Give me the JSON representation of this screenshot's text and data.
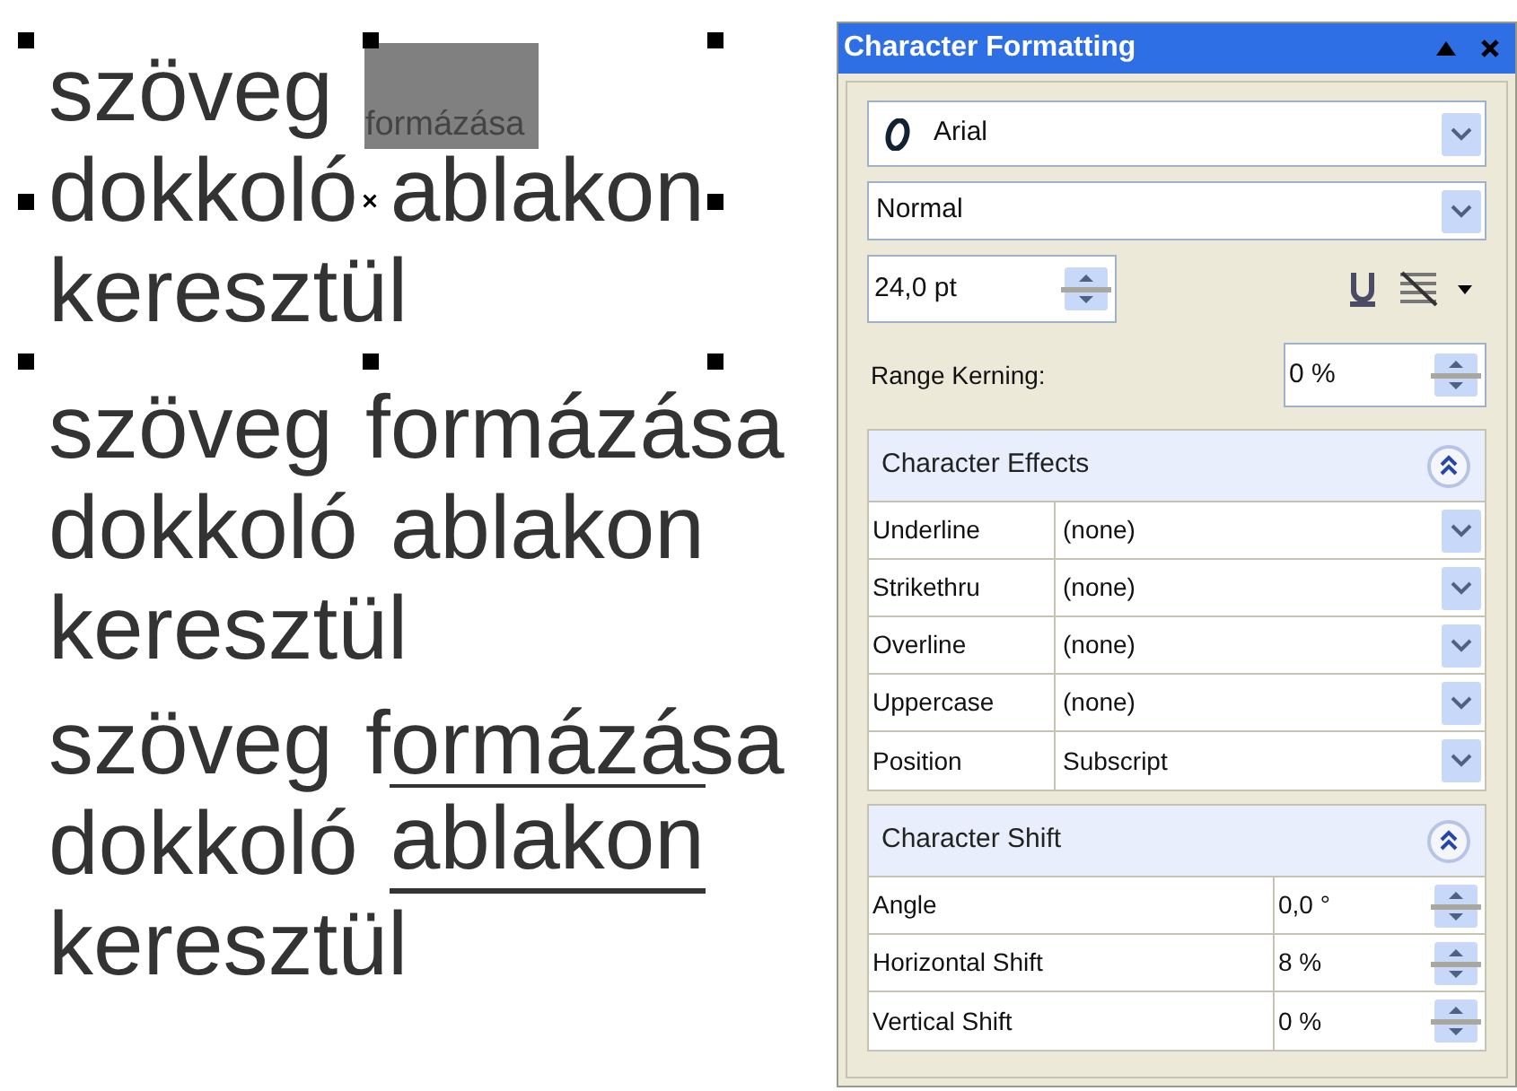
{
  "canvas": {
    "text_blocks": [
      {
        "selected": true,
        "lines": [
          [
            {
              "text": "szöveg",
              "highlighted": false,
              "subscript": false,
              "underline": false,
              "overline": false
            },
            {
              "text": "formázása",
              "highlighted": true,
              "subscript": true,
              "underline": false,
              "overline": false
            }
          ],
          [
            {
              "text": "dokkoló",
              "highlighted": false,
              "subscript": false,
              "underline": false,
              "overline": false
            },
            {
              "text": "ablakon",
              "highlighted": false,
              "subscript": false,
              "underline": false,
              "overline": false
            }
          ],
          [
            {
              "text": "keresztül",
              "highlighted": false,
              "subscript": false,
              "underline": false,
              "overline": false
            }
          ]
        ]
      },
      {
        "selected": false,
        "lines": [
          [
            {
              "text": "szöveg",
              "highlighted": false,
              "subscript": false,
              "underline": false,
              "overline": false
            },
            {
              "text": "formázása",
              "highlighted": false,
              "subscript": false,
              "underline": false,
              "overline": false
            }
          ],
          [
            {
              "text": "dokkoló",
              "highlighted": false,
              "subscript": false,
              "underline": false,
              "overline": false
            },
            {
              "text": "ablakon",
              "highlighted": false,
              "subscript": false,
              "underline": false,
              "overline": false
            }
          ],
          [
            {
              "text": "keresztül",
              "highlighted": false,
              "subscript": false,
              "underline": false,
              "overline": false
            }
          ]
        ]
      },
      {
        "selected": false,
        "lines": [
          [
            {
              "text": "szöveg",
              "highlighted": false,
              "subscript": false,
              "underline": false,
              "overline": false
            },
            {
              "text": "formázása",
              "highlighted": false,
              "subscript": false,
              "underline": false,
              "overline": false
            }
          ],
          [
            {
              "text": "dokkoló",
              "highlighted": false,
              "subscript": false,
              "underline": false,
              "overline": false
            },
            {
              "text": "ablakon",
              "highlighted": false,
              "subscript": false,
              "underline": true,
              "overline": true
            }
          ],
          [
            {
              "text": "keresztül",
              "highlighted": false,
              "subscript": false,
              "underline": false,
              "overline": false
            }
          ]
        ]
      }
    ]
  },
  "panel": {
    "title": "Character Formatting",
    "font": "Arial",
    "style": "Normal",
    "size": "24,0 pt",
    "kerning_label": "Range Kerning:",
    "kerning": "0 %",
    "sections": [
      {
        "title": "Character Effects",
        "expanded": true,
        "rows": [
          {
            "label": "Underline",
            "value": "(none)",
            "kind": "dropdown"
          },
          {
            "label": "Strikethru",
            "value": "(none)",
            "kind": "dropdown"
          },
          {
            "label": "Overline",
            "value": "(none)",
            "kind": "dropdown"
          },
          {
            "label": "Uppercase",
            "value": "(none)",
            "kind": "dropdown"
          },
          {
            "label": "Position",
            "value": "Subscript",
            "kind": "dropdown"
          }
        ]
      },
      {
        "title": "Character Shift",
        "expanded": true,
        "rows": [
          {
            "label": "Angle",
            "value": "0,0 °",
            "kind": "spinner"
          },
          {
            "label": "Horizontal Shift",
            "value": "8 %",
            "kind": "spinner"
          },
          {
            "label": "Vertical Shift",
            "value": "0 %",
            "kind": "spinner"
          }
        ]
      }
    ]
  }
}
